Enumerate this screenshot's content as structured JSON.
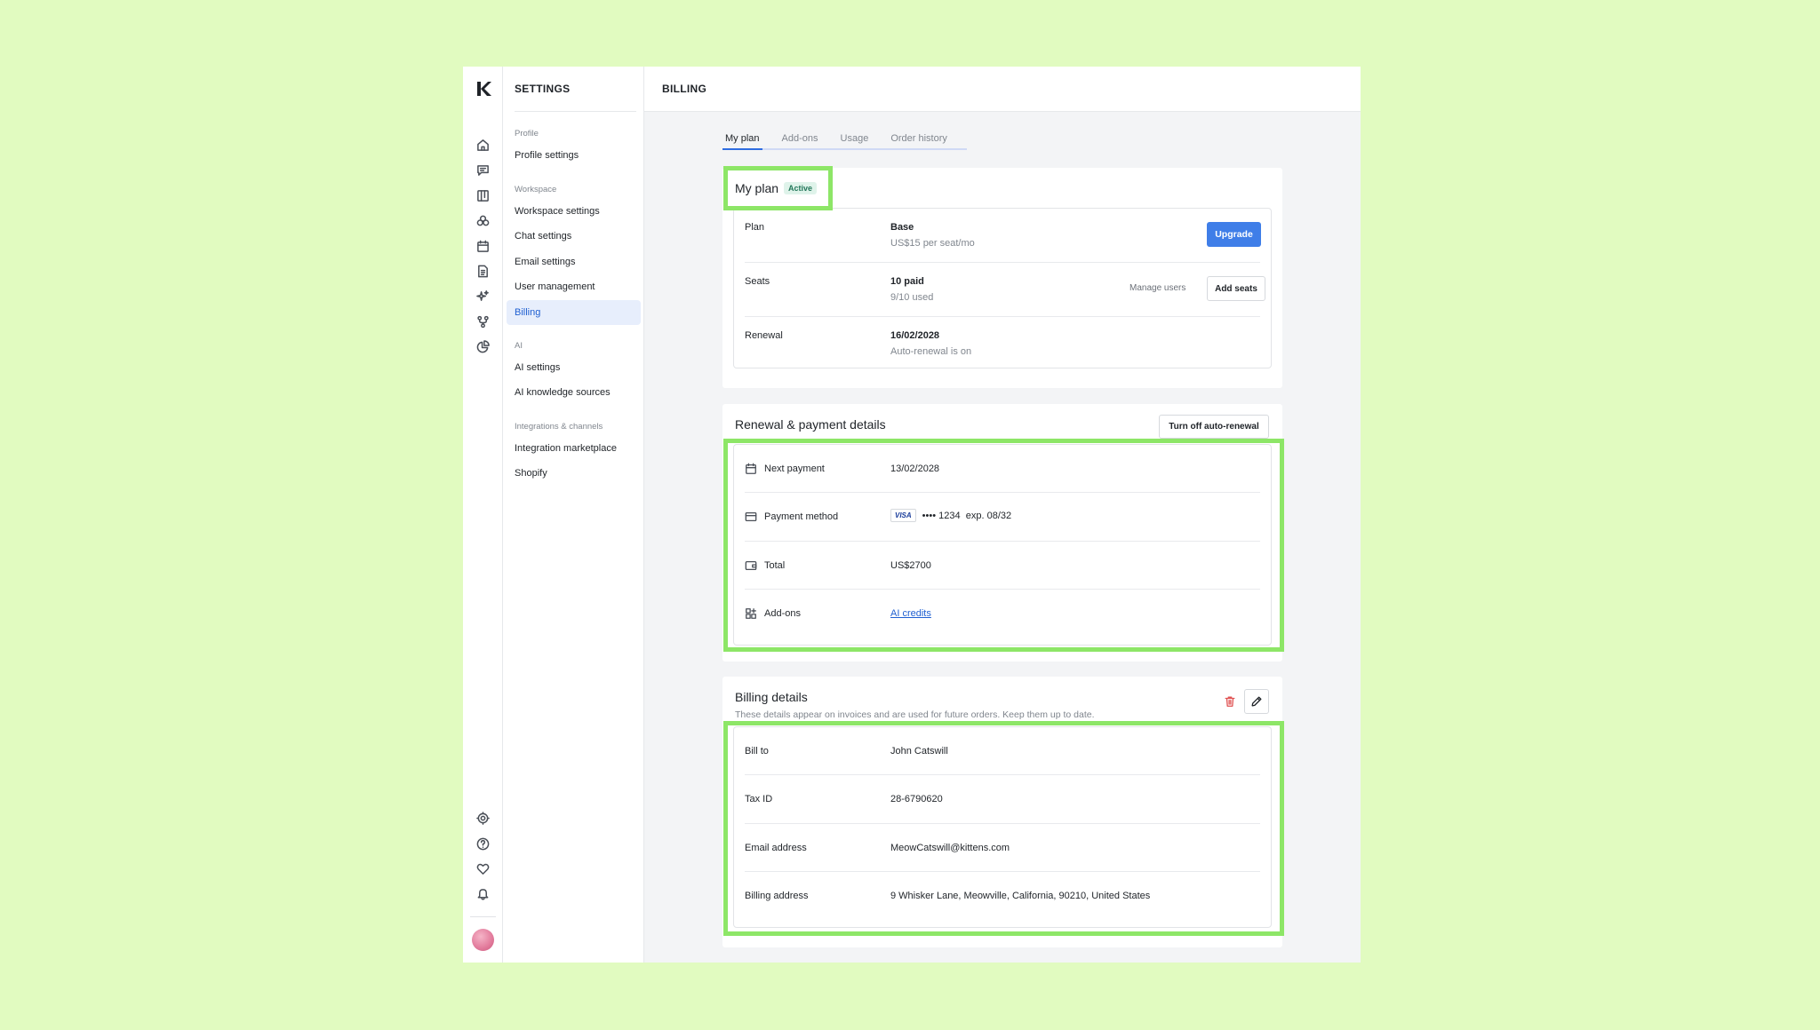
{
  "sidebar": {
    "title": "SETTINGS",
    "groups": {
      "profile": "Profile",
      "workspace": "Workspace",
      "ai": "AI",
      "integrations": "Integrations & channels"
    },
    "items": [
      "Profile settings",
      "Workspace settings",
      "Chat settings",
      "Email settings",
      "User management",
      "Billing",
      "AI settings",
      "AI knowledge sources",
      "Integration marketplace",
      "Shopify"
    ]
  },
  "rail_icons": [
    "logo-icon",
    "home-icon",
    "chat-icon",
    "board-icon",
    "contacts-icon",
    "calendar-icon",
    "document-icon",
    "sparkle-icon",
    "workflow-icon",
    "analytics-icon",
    "settings-icon",
    "help-icon",
    "heart-icon",
    "bell-icon"
  ],
  "header": {
    "title": "BILLING"
  },
  "tabs": [
    "My plan",
    "Add-ons",
    "Usage",
    "Order history"
  ],
  "plan": {
    "title": "My plan",
    "badge": "Active",
    "rows": {
      "plan_label": "Plan",
      "plan_value": "Base",
      "plan_sub": "US$15 per seat/mo",
      "upgrade": "Upgrade",
      "seats_label": "Seats",
      "seats_value": "10 paid",
      "seats_sub": "9/10 used",
      "manage_users": "Manage users",
      "add_seats": "Add seats",
      "renewal_label": "Renewal",
      "renewal_value": "16/02/2028",
      "renewal_sub": "Auto-renewal is on"
    }
  },
  "renewal": {
    "title": "Renewal & payment details",
    "turn_off": "Turn off auto-renewal",
    "next_payment_label": "Next payment",
    "next_payment_value": "13/02/2028",
    "payment_method_label": "Payment method",
    "card_brand": "VISA",
    "card_number": "•••• 1234",
    "card_exp": "exp. 08/32",
    "total_label": "Total",
    "total_value": "US$2700",
    "addons_label": "Add-ons",
    "addons_value": "AI credits"
  },
  "billing": {
    "title": "Billing details",
    "subtitle": "These details appear on invoices and are used for future orders. Keep them up to date.",
    "bill_to_label": "Bill to",
    "bill_to_value": "John Catswill",
    "tax_label": "Tax ID",
    "tax_value": "28-6790620",
    "email_label": "Email address",
    "email_value": "MeowCatswill@kittens.com",
    "address_label": "Billing address",
    "address_value": "9 Whisker Lane, Meowville, California, 90210, United States"
  },
  "colors": {
    "background": "#e1fbc0",
    "highlight": "#8de667",
    "primary": "#3f7ee8",
    "active_nav_bg": "#e7eefc",
    "danger": "#e05252"
  }
}
